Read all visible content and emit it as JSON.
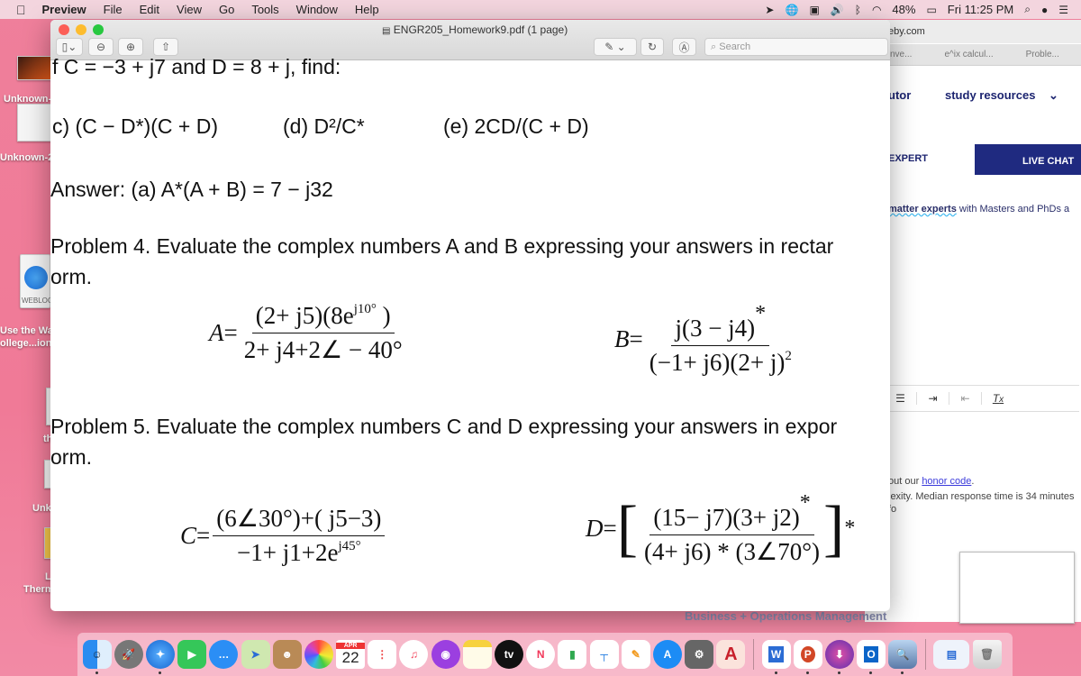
{
  "menubar": {
    "apple": "",
    "app": "Preview",
    "items": [
      "File",
      "Edit",
      "View",
      "Go",
      "Tools",
      "Window",
      "Help"
    ],
    "status": {
      "battery": "48%",
      "clock": "Fri 11:25 PM"
    }
  },
  "desktop": {
    "labels": [
      "Unknown-",
      "Unknown-2",
      "WEBLOC",
      "Use the Wai",
      "ollege...ion",
      "th",
      "Unk",
      "L",
      "Therm"
    ]
  },
  "browser": {
    "url": "eby.com",
    "bookmarks": [
      "nve...",
      "e^ix calcul...",
      "Proble..."
    ],
    "nav": [
      "utor",
      "study resources"
    ],
    "tabs": [
      "EXPERT",
      "LIVE CHAT"
    ],
    "experts_bold": "matter experts",
    "experts_rest": " with Masters and PhDs a",
    "honor_pre": "out our ",
    "honor_link": "honor code",
    "honor_post": ".",
    "median": "lexity. Median response time is 34 minutes fo",
    "background_text": "Business + Operations Management",
    "colors": {
      "brand": "#1f2a80",
      "link": "#3b3bdb"
    }
  },
  "preview": {
    "title": "ENGR205_Homework9.pdf (1 page)",
    "search_placeholder": "Search",
    "lines": {
      "given": "f C = −3 + j7 and D = 8 + j, find:",
      "c": "c)  (C − D*)(C + D)",
      "d": "(d)  D²/C*",
      "e": "(e)  2CD/(C + D)",
      "answer": "Answer: (a) A*(A + B) = 7 − j32",
      "p4": "Problem 4. Evaluate the complex numbers A and B expressing your answers in rectar",
      "p4b": "orm.",
      "p5": "Problem 5. Evaluate the complex numbers C and D expressing your answers in expor",
      "p5b": "orm."
    },
    "eq": {
      "A": {
        "lhs": "A",
        "num": "(2+ j5)(8e",
        "num_sup": "j10°",
        "num_end": " )",
        "den": "2+ j4+2∠ − 40°"
      },
      "B": {
        "lhs": "B",
        "num": "j(3 − j4)",
        "num_sup": "*",
        "den": "(−1+ j6)(2+ j)",
        "den_sup": "2"
      },
      "C": {
        "lhs": "C",
        "num": "(6∠30°)+( j5−3)",
        "den": "−1+ j1+2e",
        "den_sup": "j45°"
      },
      "D": {
        "lhs": "D",
        "num": "(15− j7)(3+ j2)",
        "num_sup": "*",
        "den": "(4+ j6) * (3∠70°)",
        "outer_sup": "*"
      }
    }
  },
  "dock": {
    "calendar_month": "APR",
    "calendar_day": "22",
    "tv": "tv",
    "word": "W",
    "powerpoint": "P",
    "outlook": "O",
    "autocad": "A"
  }
}
